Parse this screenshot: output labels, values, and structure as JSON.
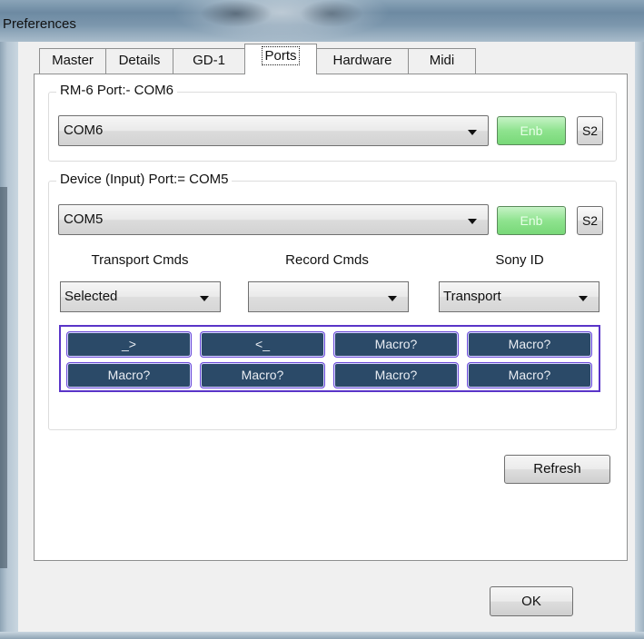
{
  "window": {
    "title": "Preferences"
  },
  "tabs": [
    {
      "label": "Master"
    },
    {
      "label": "Details"
    },
    {
      "label": "GD-1"
    },
    {
      "label": "Ports"
    },
    {
      "label": "Hardware"
    },
    {
      "label": "Midi"
    }
  ],
  "active_tab": "Ports",
  "rm6_group": {
    "legend": "RM-6 Port:- COM6",
    "port_value": "COM6",
    "enb_label": "Enb",
    "s2_label": "S2"
  },
  "device_group": {
    "legend": "Device (Input) Port:= COM5",
    "port_value": "COM5",
    "enb_label": "Enb",
    "s2_label": "S2",
    "transport_label": "Transport Cmds",
    "record_label": "Record Cmds",
    "sony_label": "Sony ID",
    "transport_value": "Selected",
    "record_value": "",
    "sony_value": "Transport",
    "macros": [
      "_>",
      "<_",
      "Macro?",
      "Macro?",
      "Macro?",
      "Macro?",
      "Macro?",
      "Macro?"
    ]
  },
  "buttons": {
    "refresh": "Refresh",
    "ok": "OK"
  },
  "colors": {
    "enb_green": "#8fe38f",
    "macro_fill": "#2b4a68",
    "macro_border": "#5a35c8"
  }
}
